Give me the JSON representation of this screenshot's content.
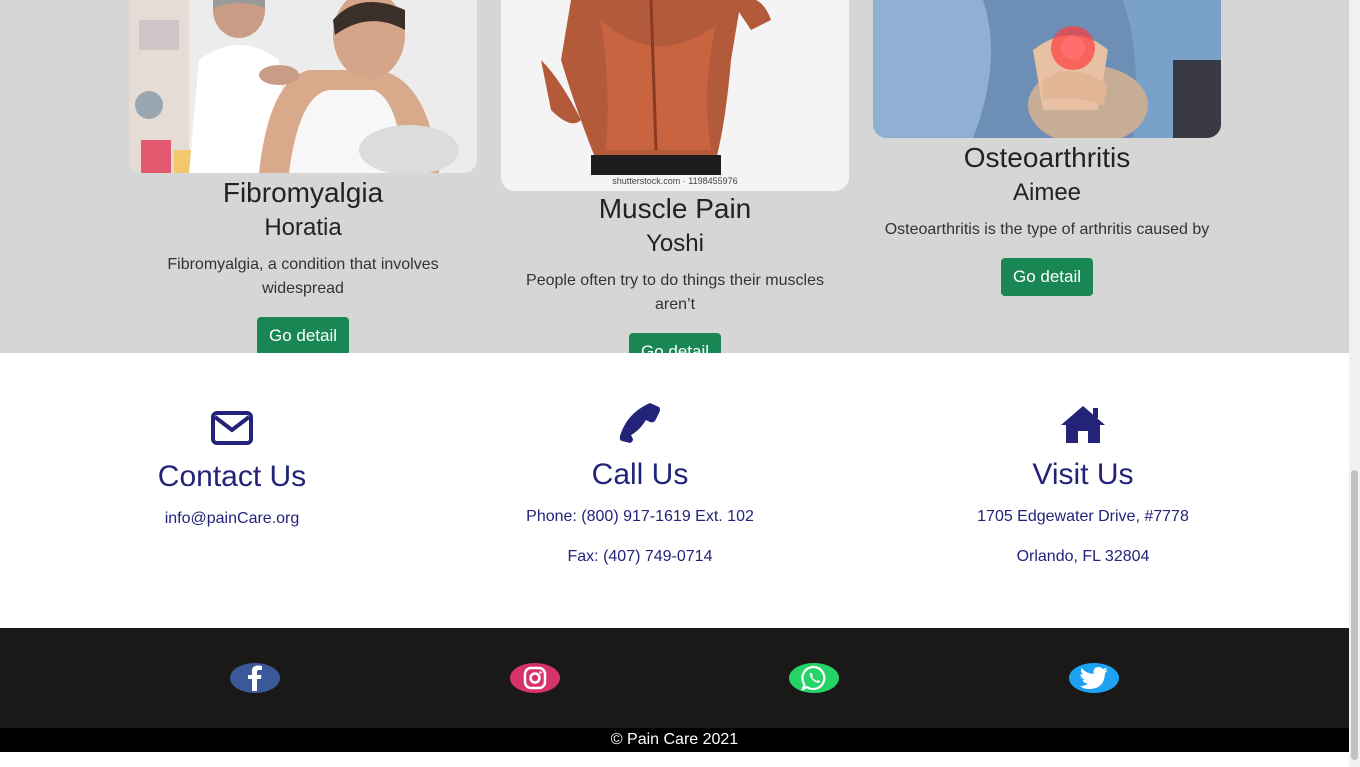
{
  "cards": [
    {
      "title": "Fibromyalgia",
      "author": "Horatia",
      "text": "Fibromyalgia, a condition that involves widespread",
      "button": "Go detail",
      "image_label": "Physiotherapist examining patient's shoulder"
    },
    {
      "title": "Muscle Pain",
      "author": "Yoshi",
      "text": "People often try to do things their muscles aren’t",
      "button": "Go detail",
      "image_label": "Back muscles highlighted",
      "watermark": "shutterstock.com · 1198455976"
    },
    {
      "title": "Osteoarthritis",
      "author": "Aimee",
      "text": "Osteoarthritis is the type of arthritis caused by",
      "button": "Go detail",
      "image_label": "Knee pain highlighted in red"
    }
  ],
  "contact": {
    "email": {
      "icon": "envelope-icon",
      "heading": "Contact Us",
      "lines": [
        "info@painCare.org"
      ]
    },
    "call": {
      "icon": "phone-icon",
      "heading": "Call Us",
      "lines": [
        "Phone: (800) 917-1619 Ext. 102",
        "Fax: (407) 749-0714"
      ]
    },
    "visit": {
      "icon": "home-icon",
      "heading": "Visit Us",
      "lines": [
        "1705 Edgewater Drive, #7778",
        "Orlando, FL 32804"
      ]
    }
  },
  "social": [
    {
      "name": "facebook-icon",
      "color": "#3b5998"
    },
    {
      "name": "instagram-icon",
      "color": "#d6336c"
    },
    {
      "name": "whatsapp-icon",
      "color": "#25d366"
    },
    {
      "name": "twitter-icon",
      "color": "#1da1f2"
    }
  ],
  "footer": {
    "copyright": "© Pain Care 2021"
  },
  "colors": {
    "accent": "#23237a",
    "button": "#198754",
    "card_bg": "#d6d6d6",
    "footer_bg": "#1b1818"
  }
}
